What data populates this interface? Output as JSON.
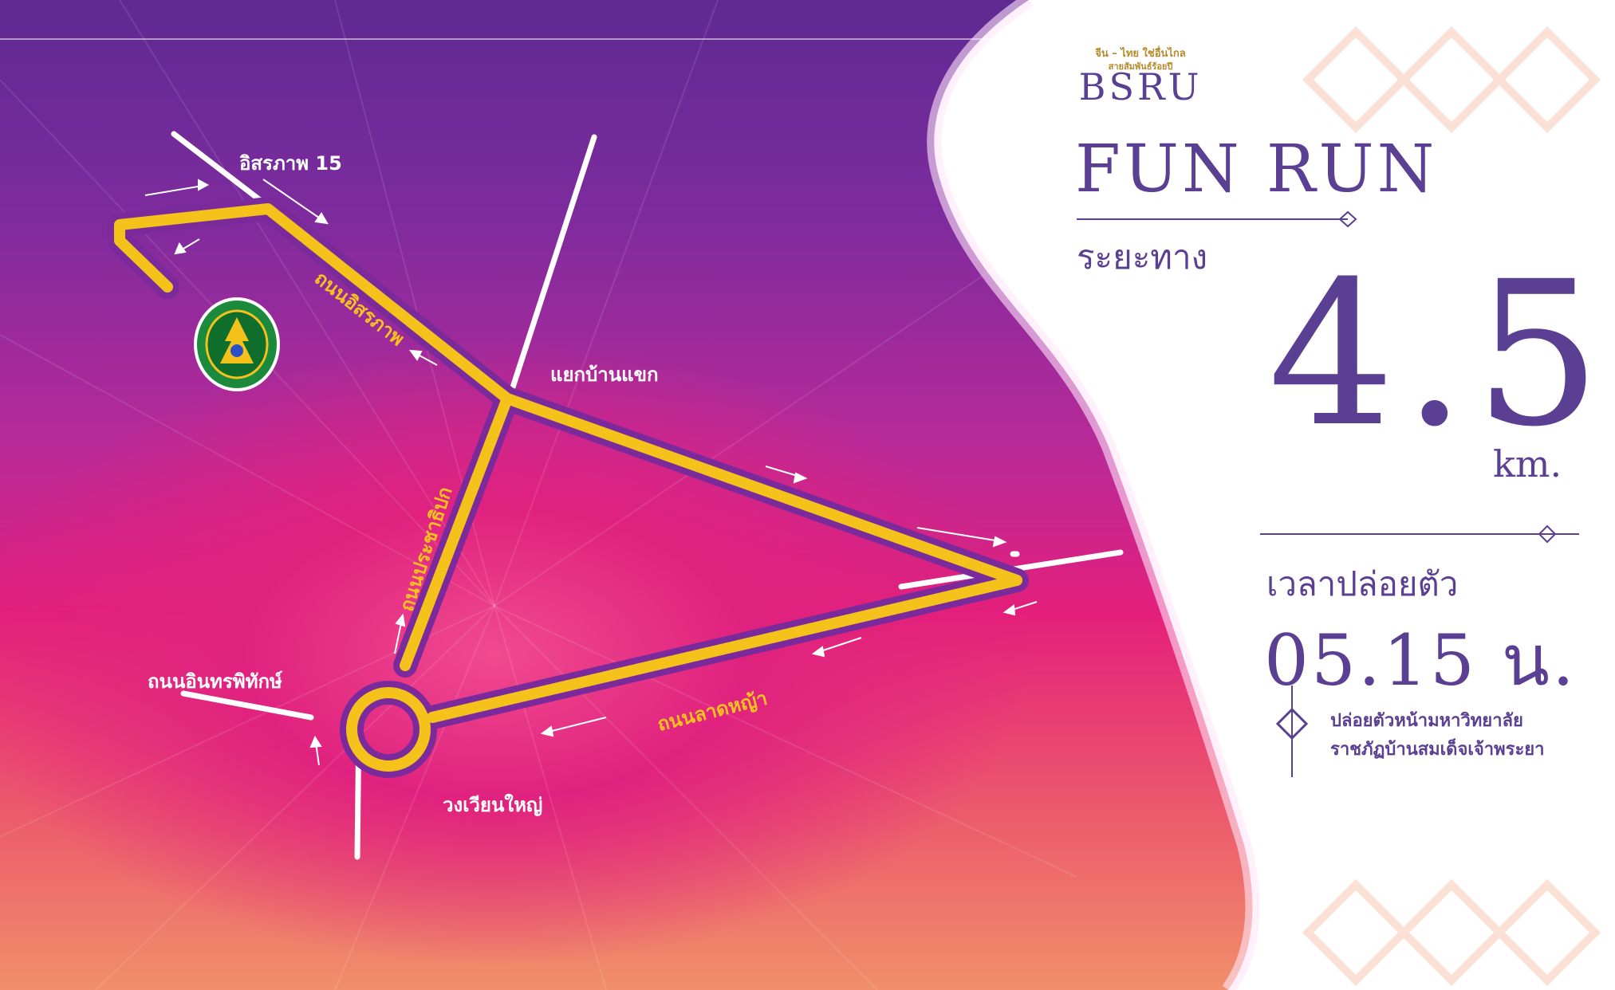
{
  "brand": {
    "tagline": "จีน – ไทย ใช่อื่นไกล",
    "subtitle": "สายสัมพันธ์ร้อยปี",
    "logo_text": "BSRU"
  },
  "title": "FUN RUN",
  "distance": {
    "label": "ระยะทาง",
    "value": "4.5",
    "unit": "km."
  },
  "start_time": {
    "label": "เวลาปล่อยตัว",
    "value": "05.15 น."
  },
  "start_location": {
    "line1": "ปล่อยตัวหน้ามหาวิทยาลัย",
    "line2": "ราชภัฏบ้านสมเด็จเจ้าพระยา"
  },
  "map": {
    "places": {
      "isaraphap15": "อิสรภาพ 15",
      "junction": "แยกบ้านแขก",
      "road_inthraphithak": "ถนนอินทรพิทักษ์",
      "roundabout": "วงเวียนใหญ่"
    },
    "roads": {
      "isaraphap": "ถนนอิสรภาพ",
      "pracharipok": "ถนนประชาธิปก",
      "lat_ya": "ถนนลาดหญ้า"
    },
    "university_seal_icon": "university-seal-icon"
  },
  "colors": {
    "route": "#f5c21b",
    "route_outline": "#7b2a9b",
    "panel_text": "#5a3f93",
    "panel_bg": "#ffffff",
    "gold": "#b48a2b"
  }
}
